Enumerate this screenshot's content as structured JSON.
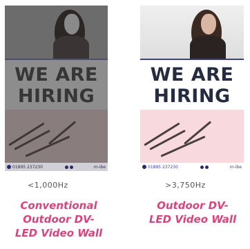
{
  "panels": {
    "left": {
      "headline_line1": "WE ARE",
      "headline_line2": "HIRING",
      "phone": "01895 237230",
      "handle": "m-ibe"
    },
    "right": {
      "headline_line1": "WE ARE",
      "headline_line2": "HIRING",
      "phone": "01895 237230",
      "handle": "m-ibe"
    }
  },
  "labels": {
    "left": {
      "frequency": "<1,000Hz",
      "caption": [
        "Conventional",
        "Outdoor DV-",
        "LED Video Wall"
      ]
    },
    "right": {
      "frequency": ">3,750Hz",
      "caption": [
        "Outdoor DV-",
        "LED Video Wall"
      ]
    }
  },
  "colors": {
    "caption": "#d8457e",
    "brand_blue": "#3e4078"
  }
}
